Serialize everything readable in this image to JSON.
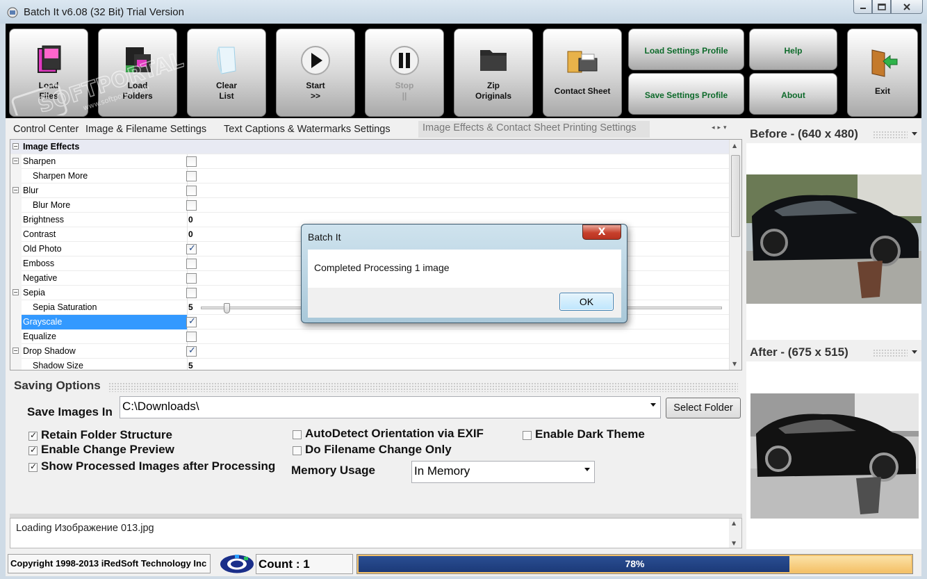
{
  "window": {
    "title": "Batch It v6.08 (32 Bit) Trial Version",
    "buttons": [
      "minimize",
      "maximize",
      "close"
    ]
  },
  "toolbar": {
    "load_files": "Load\nFiles",
    "load_folders": "Load\nFolders",
    "clear_list": "Clear\nList",
    "start": "Start\n>>",
    "stop": "Stop\n||",
    "zip_originals": "Zip\nOriginals",
    "contact_sheet": "Contact Sheet",
    "load_settings": "Load Settings Profile",
    "save_settings": "Save Settings Profile",
    "help": "Help",
    "about": "About",
    "exit": "Exit"
  },
  "tabs": {
    "control_center": "Control Center",
    "image_filename": "Image & Filename Settings",
    "text_captions": "Text Captions & Watermarks Settings",
    "image_effects": "Image Effects & Contact Sheet Printing Settings"
  },
  "grid": {
    "category": "Image Effects",
    "rows": [
      {
        "name": "Sharpen",
        "type": "check",
        "checked": false,
        "expandable": true,
        "indent": 0
      },
      {
        "name": "Sharpen More",
        "type": "check",
        "checked": false,
        "indent": 1
      },
      {
        "name": "Blur",
        "type": "check",
        "checked": false,
        "expandable": true,
        "indent": 0
      },
      {
        "name": "Blur More",
        "type": "check",
        "checked": false,
        "indent": 1
      },
      {
        "name": "Brightness",
        "type": "value",
        "value": "0",
        "indent": 0
      },
      {
        "name": "Contrast",
        "type": "value",
        "value": "0",
        "indent": 0
      },
      {
        "name": "Old Photo",
        "type": "check",
        "checked": true,
        "indent": 0
      },
      {
        "name": "Emboss",
        "type": "check",
        "checked": false,
        "indent": 0
      },
      {
        "name": "Negative",
        "type": "check",
        "checked": false,
        "indent": 0
      },
      {
        "name": "Sepia",
        "type": "check",
        "checked": false,
        "expandable": true,
        "indent": 0
      },
      {
        "name": "Sepia Saturation",
        "type": "slider",
        "value": "5",
        "indent": 1
      },
      {
        "name": "Grayscale",
        "type": "check",
        "checked": true,
        "indent": 0,
        "selected": true
      },
      {
        "name": "Equalize",
        "type": "check",
        "checked": false,
        "indent": 0
      },
      {
        "name": "Drop Shadow",
        "type": "check",
        "checked": true,
        "expandable": true,
        "indent": 0
      },
      {
        "name": "Shadow Size",
        "type": "value",
        "value": "5",
        "indent": 1
      }
    ]
  },
  "saving": {
    "header": "Saving Options",
    "save_label": "Save Images In",
    "save_path": "C:\\Downloads\\",
    "select_folder": "Select Folder",
    "retain_folder": "Retain Folder Structure",
    "enable_preview": "Enable Change Preview",
    "show_processed": "Show Processed Images after Processing",
    "autodetect": "AutoDetect Orientation via EXIF",
    "filename_only": "Do Filename Change Only",
    "dark_theme": "Enable Dark Theme",
    "memory_label": "Memory Usage",
    "memory_value": "In Memory"
  },
  "log": {
    "line": "Loading Изображение 013.jpg"
  },
  "status": {
    "copyright": "Copyright 1998-2013 iRedSoft Technology Inc",
    "count": "Count : 1",
    "progress_text": "78%",
    "progress_value": 0.78
  },
  "preview": {
    "before": "Before - (640 x 480)",
    "after": "After - (675 x 515)"
  },
  "dialog": {
    "title": "Batch It",
    "message": "Completed Processing 1 image",
    "ok": "OK",
    "close": "X"
  },
  "watermark": {
    "text": "SOFTPORTAL",
    "url": "www.softportal.com"
  },
  "colors": {
    "selection": "#3399ff",
    "settings_text": "#0d6a2a",
    "progress_fill": "#1c3a78",
    "progress_rest": "#f4c168"
  }
}
